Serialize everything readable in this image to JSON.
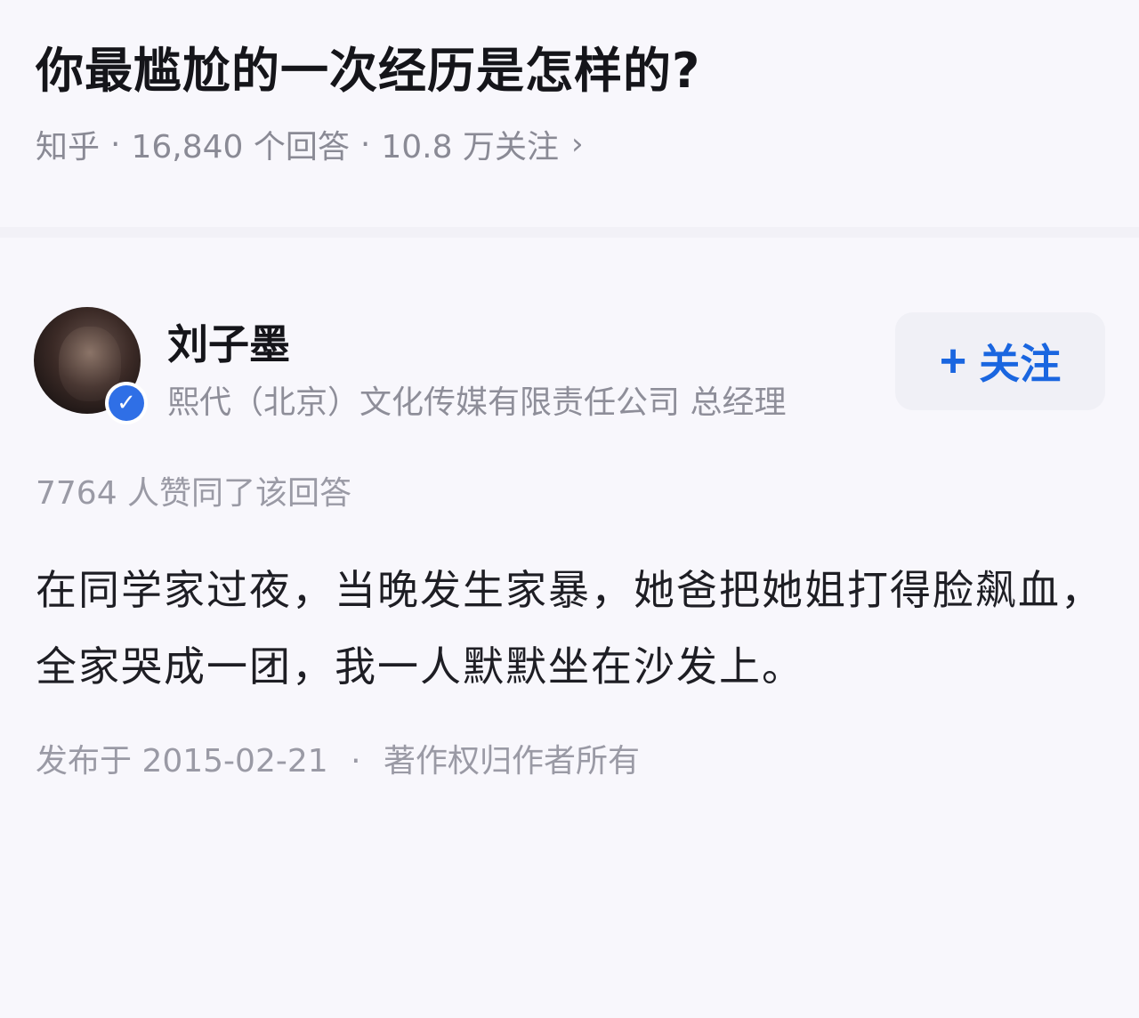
{
  "question": {
    "title": "你最尴尬的一次经历是怎样的?",
    "source": "知乎",
    "answers_count": "16,840 个回答",
    "followers": "10.8 万关注"
  },
  "author": {
    "name": "刘子墨",
    "description": "熙代（北京）文化传媒有限责任公司 总经理",
    "follow_label": "关注",
    "avatar_icon": "avatar-photo",
    "verified_icon": "verified-check-icon"
  },
  "answer": {
    "votes_text": "7764 人赞同了该回答",
    "content": "在同学家过夜，当晚发生家暴，她爸把她姐打得脸飙血，全家哭成一团，我一人默默坐在沙发上。",
    "published": "发布于 2015-02-21",
    "copyright": "著作权归作者所有"
  },
  "colors": {
    "accent": "#1a66e0",
    "badge": "#2f6fe6",
    "background": "#f8f7fc",
    "muted_text": "#8e8e99"
  }
}
